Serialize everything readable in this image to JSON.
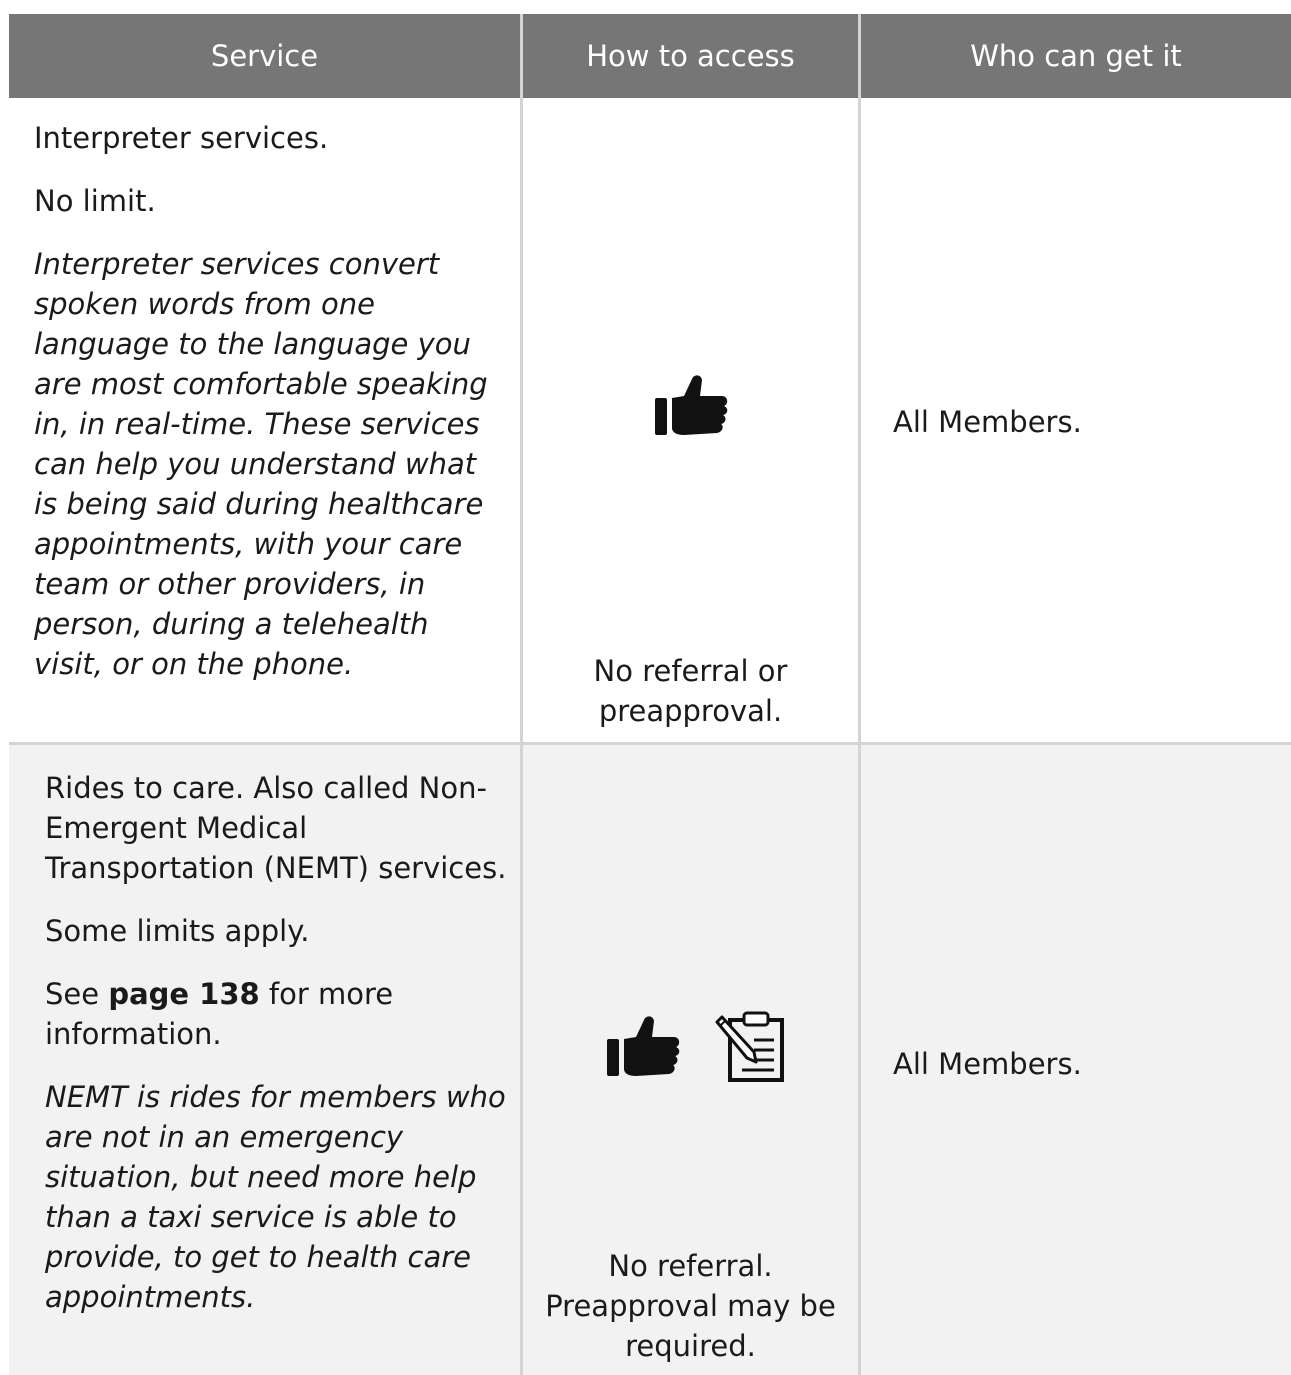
{
  "header": {
    "service": "Service",
    "how_to_access": "How to access",
    "who_can_get_it": "Who can get it"
  },
  "rows": [
    {
      "service_name": "Interpreter services.",
      "service_limit": "No limit.",
      "service_description": "Interpreter services convert spoken words from one language to the language you are most comfortable speaking in, in real-time. These services can help you understand what is being said during healthcare appointments, with your care team or other providers, in person, during a telehealth visit, or on the phone.",
      "access_icons": [
        "thumbs-up-icon"
      ],
      "access_note": "No referral or preapproval.",
      "eligibility": "All Members."
    },
    {
      "service_name": "Rides to care. Also called Non-Emergent Medical Transportation (NEMT) services.",
      "service_limit": "Some limits apply.",
      "see_prefix": "See ",
      "see_link": "page 138",
      "see_suffix": " for more information.",
      "service_description": "NEMT is rides for members who are not in an emergency situation, but need more help than a taxi service is able to provide, to get to health care appointments.",
      "access_icons": [
        "thumbs-up-icon",
        "clipboard-pen-icon"
      ],
      "access_note": "No referral. Preapproval may be required.",
      "eligibility": "All Members."
    }
  ]
}
